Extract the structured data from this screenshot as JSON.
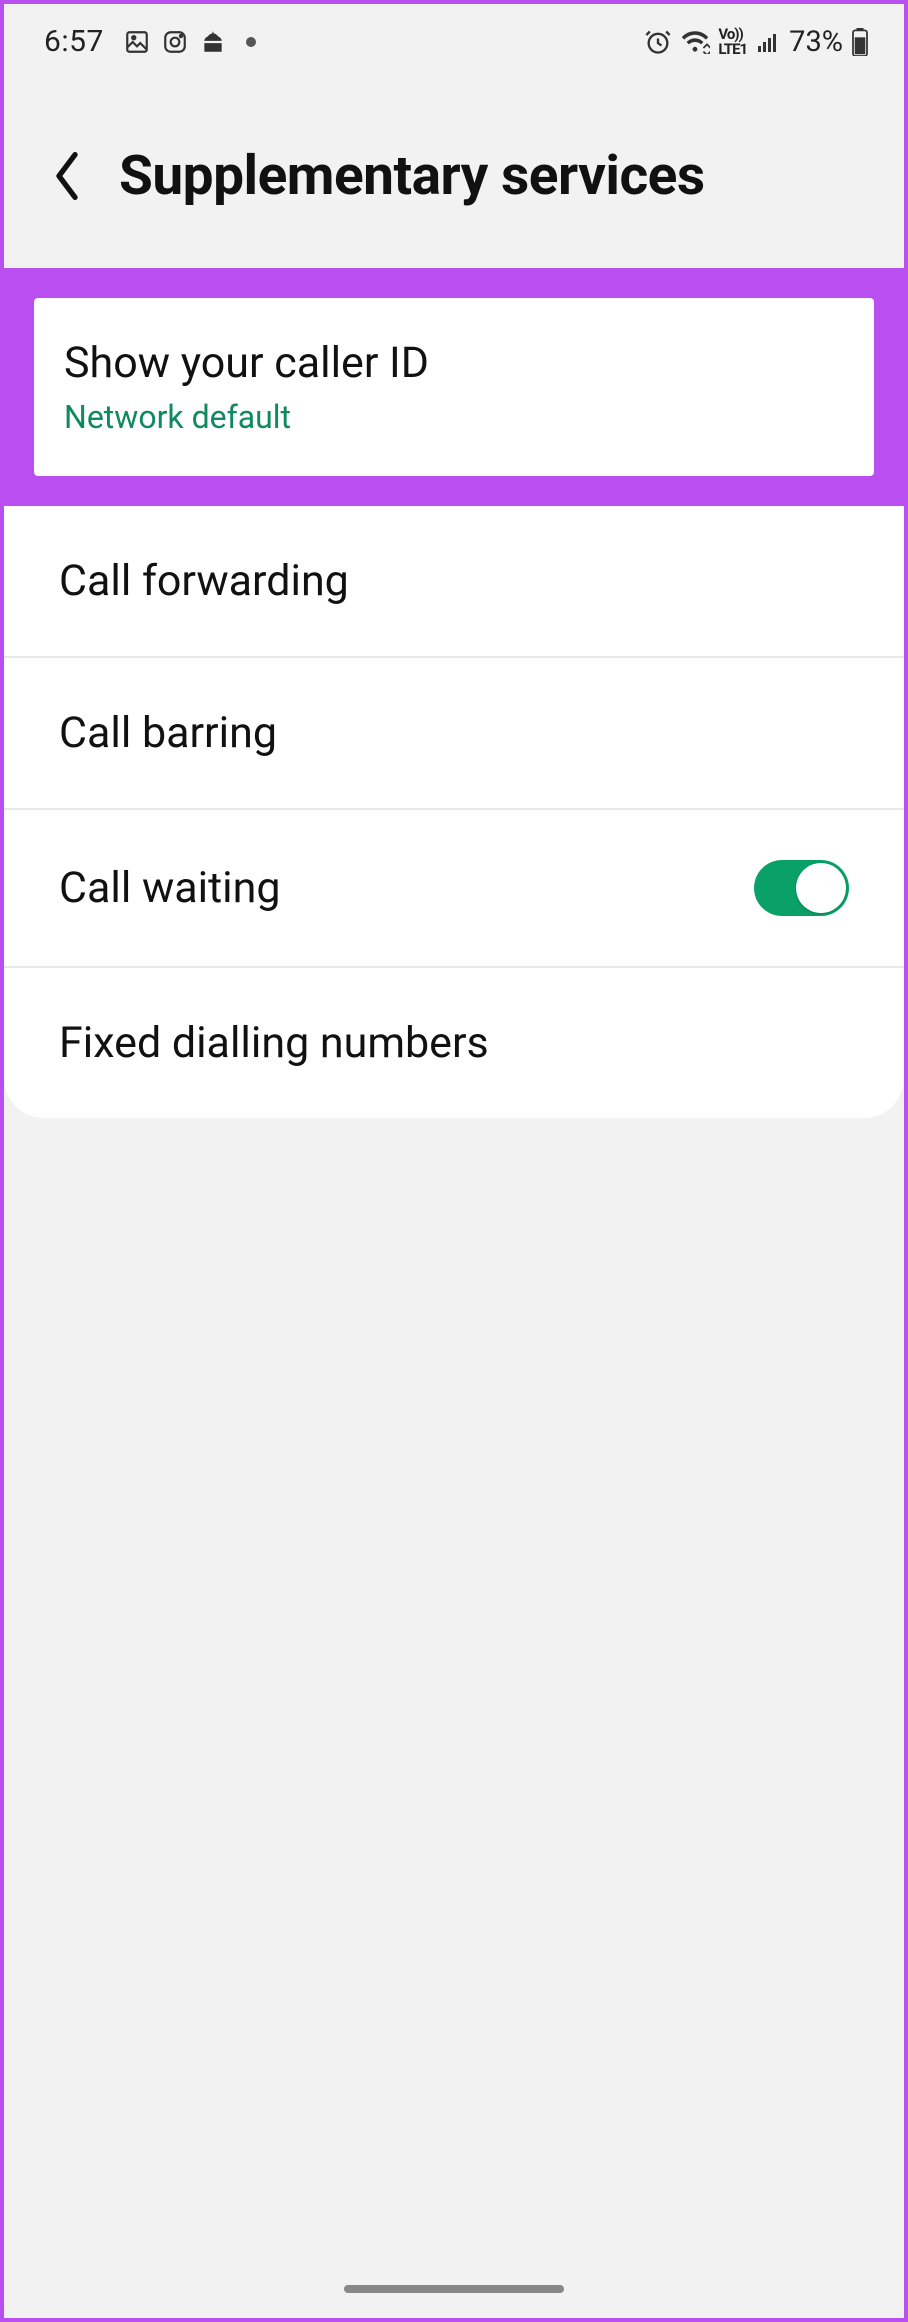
{
  "status": {
    "time": "6:57",
    "battery": "73%"
  },
  "header": {
    "title": "Supplementary services"
  },
  "highlight": {
    "title": "Show your caller ID",
    "subtitle": "Network default"
  },
  "items": [
    {
      "label": "Call forwarding",
      "toggle": false,
      "has_toggle": false
    },
    {
      "label": "Call barring",
      "toggle": false,
      "has_toggle": false
    },
    {
      "label": "Call waiting",
      "toggle": true,
      "has_toggle": true
    },
    {
      "label": "Fixed dialling numbers",
      "toggle": false,
      "has_toggle": false
    }
  ]
}
